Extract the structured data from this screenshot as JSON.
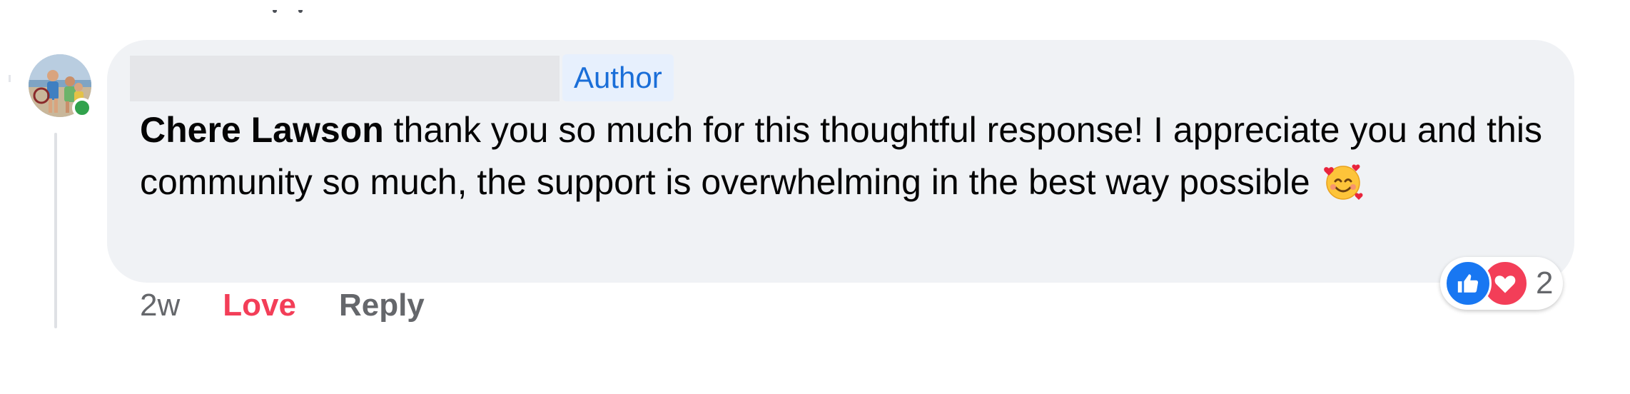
{
  "comment": {
    "author_badge": "Author",
    "author_name": "Chere Lawson",
    "text": " thank you so much for this thoughtful response! I appreciate you and this community so much, the support is overwhelming in the best way possible ",
    "emoji": "smiling-face-with-hearts",
    "online_status_color": "#31a24c"
  },
  "actions": {
    "time": "2w",
    "love_label": "Love",
    "reply_label": "Reply"
  },
  "reactions": {
    "types": [
      "like",
      "love"
    ],
    "count": "2"
  },
  "colors": {
    "bubble_bg": "#f0f2f5",
    "love": "#f33e58",
    "like": "#1877f2",
    "badge_text": "#1a6ed8",
    "badge_bg": "#e7f0fd",
    "secondary_text": "#65676b"
  }
}
